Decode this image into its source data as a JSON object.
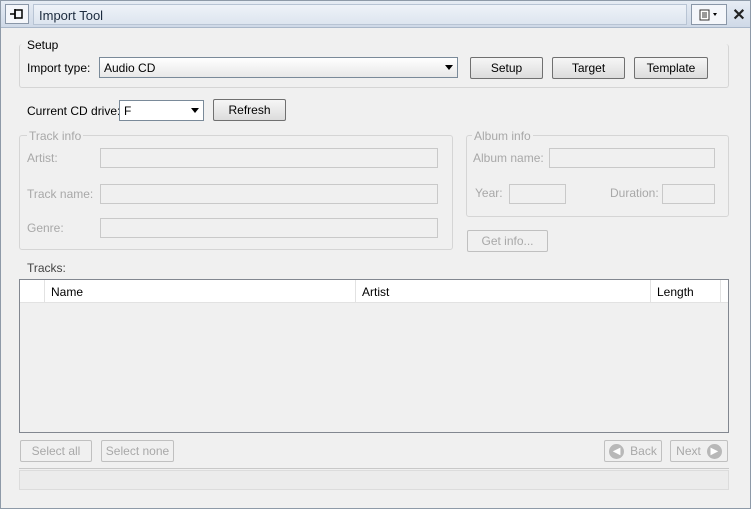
{
  "window": {
    "title": "Import Tool",
    "pin_icon": "pin-icon",
    "properties_icon": "properties-icon",
    "close_icon": "close-icon",
    "close_glyph": "✕"
  },
  "setup": {
    "group_label": "Setup",
    "import_type_label": "Import type:",
    "import_type_value": "Audio CD",
    "setup_button": "Setup",
    "target_button": "Target",
    "template_button": "Template"
  },
  "cd": {
    "drive_label": "Current CD drive:",
    "drive_value": "F",
    "refresh_button": "Refresh"
  },
  "track_info": {
    "group_label": "Track info",
    "artist_label": "Artist:",
    "track_name_label": "Track name:",
    "genre_label": "Genre:",
    "artist_value": "",
    "track_name_value": "",
    "genre_value": ""
  },
  "album_info": {
    "group_label": "Album info",
    "album_name_label": "Album name:",
    "year_label": "Year:",
    "duration_label": "Duration:",
    "album_name_value": "",
    "year_value": "",
    "duration_value": "",
    "get_info_button": "Get info..."
  },
  "tracks": {
    "label": "Tracks:",
    "columns": [
      "",
      "Name",
      "Artist",
      "Length"
    ],
    "rows": []
  },
  "footer": {
    "select_all_button": "Select all",
    "select_none_button": "Select none",
    "back_button": "Back",
    "next_button": "Next",
    "status_text": ""
  }
}
